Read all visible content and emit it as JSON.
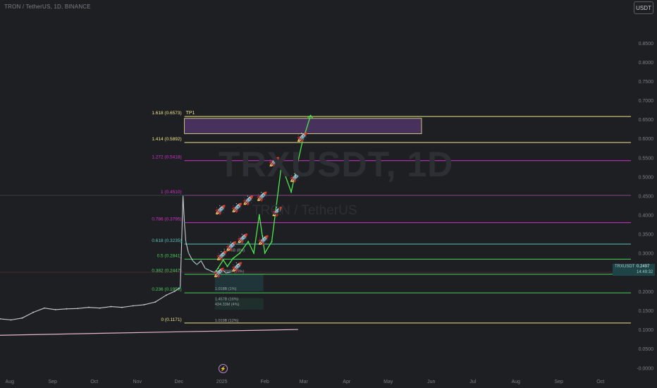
{
  "header": {
    "title": "TRON / TetherUS, 1D, BINANCE",
    "currency_button": "USDT"
  },
  "watermark": {
    "symbol": "TRXUSDT, 1D",
    "name": "TRON / TetherUS"
  },
  "price_tag": {
    "symbol": "TRXUSDT",
    "price": "0.2497",
    "countdown": "14:49:32"
  },
  "colors": {
    "background": "#1e1f23",
    "price_line": "#e5b7c9",
    "fib_yellow": "#f0e68c",
    "fib_magenta": "#d133c8",
    "fib_teal": "#5bc6b8",
    "fib_green": "#49d15c",
    "projection": "#4ce84c",
    "zone": "#6b3f8d"
  },
  "event_icon": "lightning-icon",
  "chart_data": {
    "type": "line",
    "title": "TRXUSDT, 1D",
    "y_ticks": [
      "0.8500",
      "0.8000",
      "0.7500",
      "0.7000",
      "0.6500",
      "0.6000",
      "0.5500",
      "0.5000",
      "0.4500",
      "0.4000",
      "0.3500",
      "0.3000",
      "0.2500",
      "0.2000",
      "0.1500",
      "0.1000",
      "0.0500",
      "-0.0000"
    ],
    "x_ticks": [
      "Aug",
      "Sep",
      "Oct",
      "Nov",
      "Dec",
      "2025",
      "Feb",
      "Mar",
      "Apr",
      "May",
      "Jun",
      "Jul",
      "Aug",
      "Sep",
      "Oct"
    ],
    "ylim": [
      -0.0069,
      0.9068
    ],
    "xlim": [
      "2024-07-25",
      "2025-10-23"
    ],
    "grid": false,
    "price_series": {
      "name": "TRX price",
      "x": [
        "2024-07-25",
        "2024-08-02",
        "2024-08-10",
        "2024-08-18",
        "2024-08-26",
        "2024-09-03",
        "2024-09-11",
        "2024-09-19",
        "2024-09-27",
        "2024-10-05",
        "2024-10-13",
        "2024-10-21",
        "2024-10-29",
        "2024-11-06",
        "2024-11-14",
        "2024-11-22",
        "2024-11-28",
        "2024-12-02",
        "2024-12-03",
        "2024-12-04",
        "2024-12-05",
        "2024-12-06",
        "2024-12-08",
        "2024-12-11",
        "2024-12-14",
        "2024-12-17",
        "2024-12-20",
        "2024-12-23",
        "2024-12-26",
        "2024-12-29",
        "2025-01-01",
        "2025-01-04",
        "2025-01-07"
      ],
      "y": [
        0.128,
        0.125,
        0.13,
        0.145,
        0.156,
        0.152,
        0.154,
        0.155,
        0.158,
        0.156,
        0.16,
        0.158,
        0.162,
        0.165,
        0.172,
        0.19,
        0.2,
        0.21,
        0.33,
        0.45,
        0.38,
        0.33,
        0.3,
        0.28,
        0.27,
        0.28,
        0.26,
        0.255,
        0.25,
        0.252,
        0.258,
        0.248,
        0.2497
      ]
    },
    "projection": {
      "name": "projected path",
      "x": [
        "2024-12-28",
        "2025-01-02",
        "2025-01-05",
        "2025-01-09",
        "2025-01-14",
        "2025-01-20",
        "2025-01-24",
        "2025-01-28",
        "2025-02-01",
        "2025-02-06",
        "2025-02-13",
        "2025-02-20",
        "2025-02-28",
        "2025-03-06"
      ],
      "y": [
        0.254,
        0.282,
        0.265,
        0.286,
        0.3,
        0.33,
        0.3,
        0.4,
        0.3,
        0.33,
        0.53,
        0.46,
        0.59,
        0.66
      ]
    },
    "fib_levels": [
      {
        "label": "1.618 (0.6573)",
        "value": 0.6573,
        "color": "yellow"
      },
      {
        "label": "1.414 (0.5892)",
        "value": 0.5892,
        "color": "yellow"
      },
      {
        "label": "1.272 (0.5418)",
        "value": 0.5418,
        "color": "magenta"
      },
      {
        "label": "1 (0.4510)",
        "value": 0.451,
        "color": "magenta"
      },
      {
        "label": "0.786 (0.3795)",
        "value": 0.3795,
        "color": "magenta"
      },
      {
        "label": "0.618 (0.3235)",
        "value": 0.3235,
        "color": "teal"
      },
      {
        "label": "0.5 (0.2841)",
        "value": 0.2841,
        "color": "green"
      },
      {
        "label": "0.382 (0.2447)",
        "value": 0.2447,
        "color": "green"
      },
      {
        "label": "0.236 (0.1959)",
        "value": 0.1959,
        "color": "green"
      },
      {
        "label": "0 (0.1171)",
        "value": 0.1171,
        "color": "yellow"
      }
    ],
    "tp_label": "TP1",
    "target_zone": {
      "y_low": 0.6123,
      "y_high": 0.6525,
      "x_start": "2024-12-05",
      "x_end": "2025-05-25"
    },
    "small_labels": [
      {
        "text": "1.876B (8%)",
        "value": 0.3,
        "x": "2025-01-02"
      },
      {
        "text": "4.798B (23%)",
        "value": 0.2447,
        "x": "2024-12-31"
      },
      {
        "text": "1.018B (1%)",
        "value": 0.1995,
        "x": "2024-12-27"
      },
      {
        "text": "1.457B (16%)",
        "value": 0.1735,
        "x": "2024-12-27"
      },
      {
        "text": "434.33M (4%)",
        "value": 0.1595,
        "x": "2024-12-27"
      },
      {
        "text": "1.019B (12%)",
        "value": 0.1171,
        "x": "2024-12-27"
      }
    ]
  }
}
